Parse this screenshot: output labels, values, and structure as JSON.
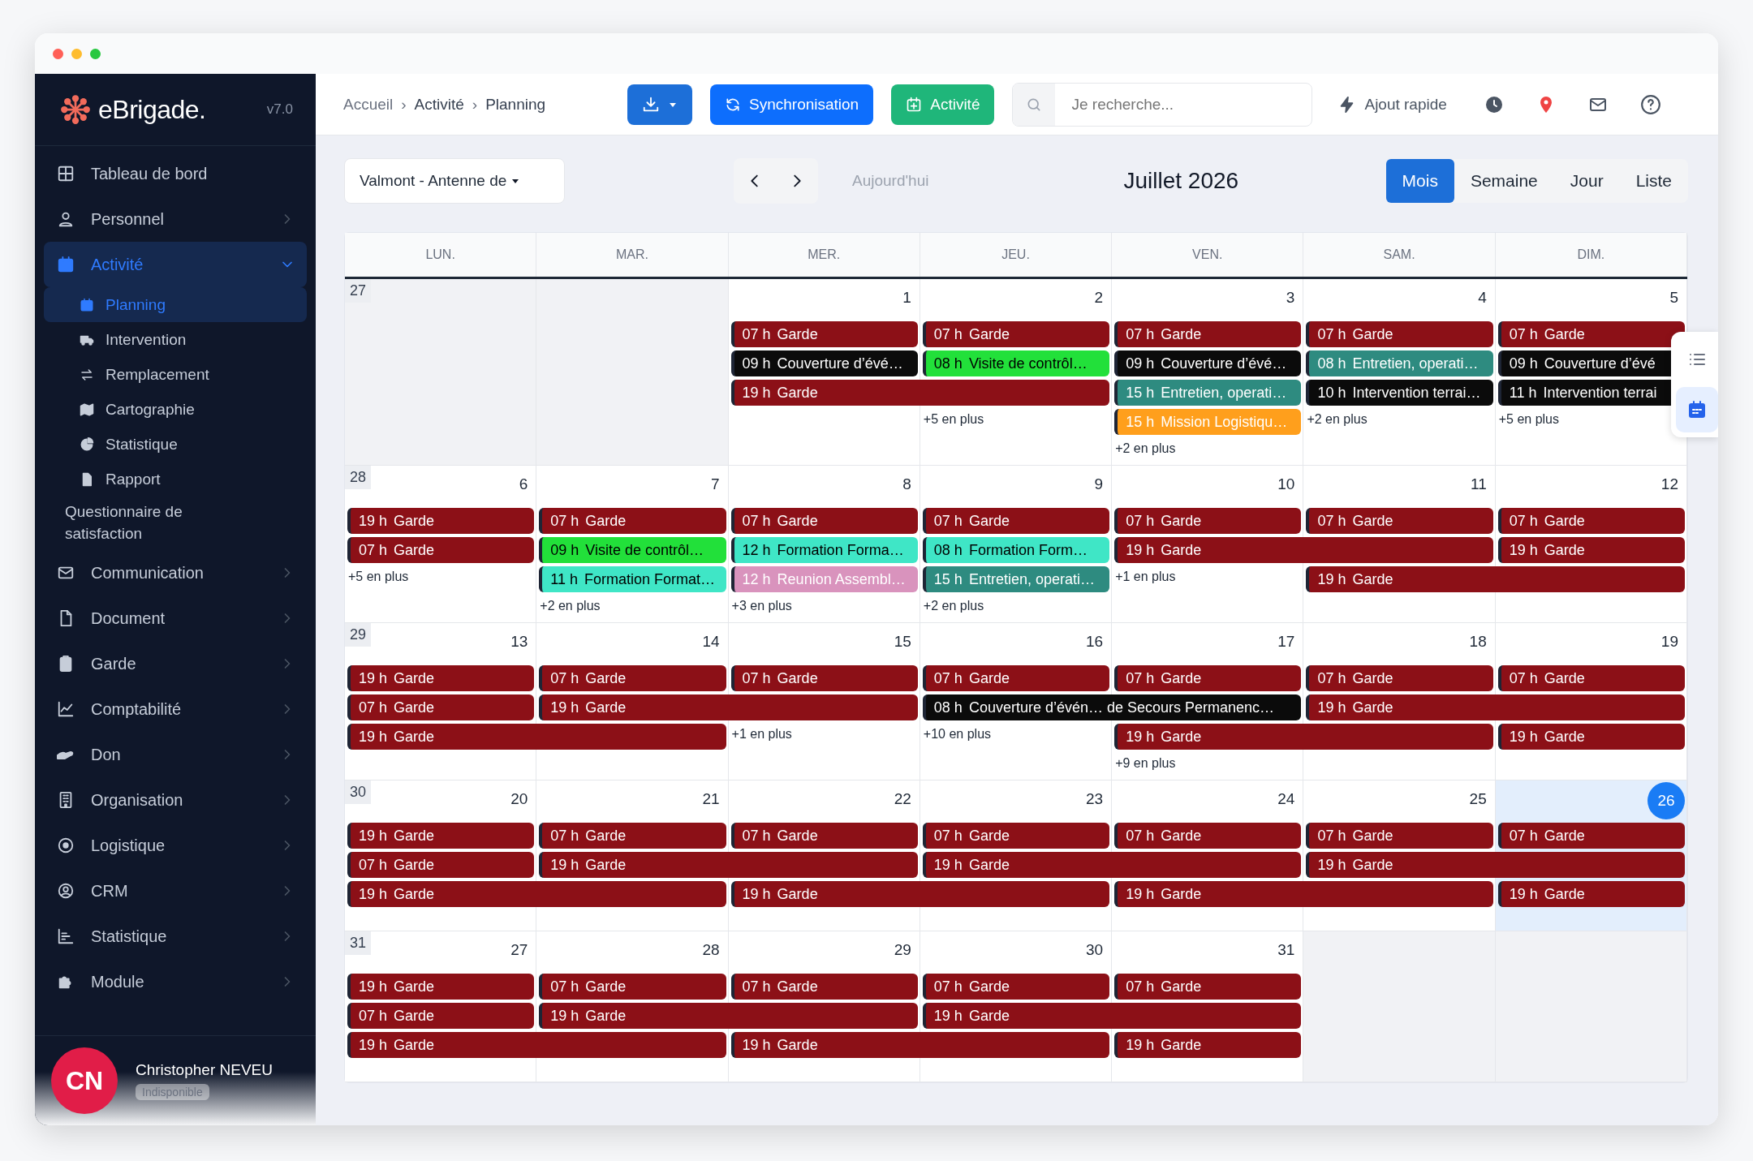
{
  "sidebar": {
    "logo": "eBrigade.",
    "version": "v7.0",
    "items": [
      {
        "label": "Tableau de bord",
        "selected": false
      },
      {
        "label": "Personnel",
        "selected": false,
        "expanded": false
      },
      {
        "label": "Activité",
        "selected": true,
        "expanded": true,
        "children": [
          {
            "label": "Planning",
            "selected": true
          },
          {
            "label": "Intervention",
            "selected": false
          },
          {
            "label": "Remplacement",
            "selected": false
          },
          {
            "label": "Cartographie",
            "selected": false
          },
          {
            "label": "Statistique",
            "selected": false
          },
          {
            "label": "Rapport",
            "selected": false
          },
          {
            "label": "Questionnaire de satisfaction",
            "selected": false
          }
        ]
      },
      {
        "label": "Communication",
        "selected": false,
        "expanded": false
      },
      {
        "label": "Document",
        "selected": false,
        "expanded": false
      },
      {
        "label": "Garde",
        "selected": false,
        "expanded": false
      },
      {
        "label": "Comptabilité",
        "selected": false,
        "expanded": false
      },
      {
        "label": "Don",
        "selected": false,
        "expanded": false
      },
      {
        "label": "Organisation",
        "selected": false,
        "expanded": false
      },
      {
        "label": "Logistique",
        "selected": false,
        "expanded": false
      },
      {
        "label": "CRM",
        "selected": false,
        "expanded": false
      },
      {
        "label": "Statistique",
        "selected": false,
        "expanded": false
      },
      {
        "label": "Module",
        "selected": false,
        "expanded": false
      }
    ],
    "user": {
      "initials": "CN",
      "name": "Christopher NEVEU",
      "status": "Indisponible"
    }
  },
  "header": {
    "breadcrumb": [
      {
        "label": "Accueil",
        "separator": "›"
      },
      {
        "label": "Activité",
        "separator": "›"
      },
      {
        "label": "Planning"
      }
    ],
    "buttons": [
      {
        "kind": "download"
      },
      {
        "kind": "sync",
        "label": "Synchronisation"
      },
      {
        "kind": "add",
        "label": "Activité"
      }
    ],
    "search": {
      "placeholder": "Je recherche..."
    },
    "quick_add": "Ajout rapide"
  },
  "toolbar": {
    "unit_select": "Valmont - Antenne de",
    "today": {
      "label": "Aujourd'hui",
      "disabled": true
    },
    "title": "Juillet 2026",
    "views": [
      {
        "label": "Mois",
        "selected": true
      },
      {
        "label": "Semaine",
        "selected": false
      },
      {
        "label": "Jour",
        "selected": false
      },
      {
        "label": "Liste",
        "selected": false
      }
    ]
  },
  "side_views": [
    {
      "kind": "list",
      "selected": false
    },
    {
      "kind": "calendar",
      "selected": true
    }
  ],
  "calendar": {
    "day_names": [
      "LUN.",
      "MAR.",
      "MER.",
      "JEU.",
      "VEN.",
      "SAM.",
      "DIM."
    ],
    "weeks": [
      {
        "number": "27",
        "days": [
          {
            "in_month": false,
            "today": false
          },
          {
            "in_month": false,
            "today": false
          },
          {
            "date": "1",
            "in_month": true,
            "today": false,
            "events": [
              {
                "time": "07 h",
                "title": "Garde",
                "color": "#8c1017",
                "continues": false
              },
              {
                "time": "09 h",
                "title": "Couverture d’évé…",
                "color": "#0b0b0b",
                "continues": false
              },
              {
                "time": "19 h",
                "title": "Garde",
                "color": "#8c1017",
                "continues": true
              }
            ]
          },
          {
            "date": "2",
            "in_month": true,
            "today": false,
            "events": [
              {
                "time": "07 h",
                "title": "Garde",
                "color": "#8c1017",
                "continues": false
              },
              {
                "time": "08 h",
                "title": "Visite de contrôl…",
                "color": "#22e03a",
                "continues": false
              }
            ],
            "more": "+5 en plus"
          },
          {
            "date": "3",
            "in_month": true,
            "today": false,
            "events": [
              {
                "time": "07 h",
                "title": "Garde",
                "color": "#8c1017",
                "continues": false
              },
              {
                "time": "09 h",
                "title": "Couverture d’évé…",
                "color": "#0b0b0b",
                "continues": false
              },
              {
                "time": "15 h",
                "title": "Entretien, operati…",
                "color": "#2e8b80",
                "continues": false
              },
              {
                "time": "15 h",
                "title": "Mission Logistiqu…",
                "color": "#ff9f1c",
                "continues": false
              }
            ],
            "more": "+2 en plus"
          },
          {
            "date": "4",
            "in_month": true,
            "today": false,
            "events": [
              {
                "time": "07 h",
                "title": "Garde",
                "color": "#8c1017",
                "continues": false
              },
              {
                "time": "08 h",
                "title": "Entretien, operati…",
                "color": "#2e8b80",
                "continues": false
              },
              {
                "time": "10 h",
                "title": "Intervention terrai…",
                "color": "#0b0b0b",
                "continues": false
              }
            ],
            "more": "+2 en plus"
          },
          {
            "date": "5",
            "in_month": true,
            "today": false,
            "events": [
              {
                "time": "07 h",
                "title": "Garde",
                "color": "#8c1017",
                "continues": false
              },
              {
                "time": "09 h",
                "title": "Couverture d’évé",
                "color": "#0b0b0b",
                "continues": false
              },
              {
                "time": "11 h",
                "title": "Intervention terrai",
                "color": "#0b0b0b",
                "continues": false
              }
            ],
            "more": "+5 en plus"
          }
        ]
      },
      {
        "number": "28",
        "days": [
          {
            "date": "6",
            "in_month": true,
            "today": false,
            "events": [
              {
                "time": "19 h",
                "title": "Garde",
                "color": "#8c1017",
                "continues": false
              },
              {
                "time": "07 h",
                "title": "Garde",
                "color": "#8c1017",
                "continues": false
              }
            ],
            "more": "+5 en plus"
          },
          {
            "date": "7",
            "in_month": true,
            "today": false,
            "events": [
              {
                "time": "07 h",
                "title": "Garde",
                "color": "#8c1017",
                "continues": false
              },
              {
                "time": "09 h",
                "title": "Visite de contrôl…",
                "color": "#22e03a",
                "continues": false
              },
              {
                "time": "11 h",
                "title": "Formation Format…",
                "color": "#3fe6c6",
                "continues": false
              }
            ],
            "more": "+2 en plus"
          },
          {
            "date": "8",
            "in_month": true,
            "today": false,
            "events": [
              {
                "time": "07 h",
                "title": "Garde",
                "color": "#8c1017",
                "continues": false
              },
              {
                "time": "12 h",
                "title": "Formation Forma…",
                "color": "#3fe6c6",
                "continues": false
              },
              {
                "time": "12 h",
                "title": "Reunion Assembl…",
                "color": "#d993bd",
                "continues": false
              }
            ],
            "more": "+3 en plus"
          },
          {
            "date": "9",
            "in_month": true,
            "today": false,
            "events": [
              {
                "time": "07 h",
                "title": "Garde",
                "color": "#8c1017",
                "continues": false
              },
              {
                "time": "08 h",
                "title": "Formation Form…",
                "color": "#3fe6c6",
                "continues": false
              },
              {
                "time": "15 h",
                "title": "Entretien, operati…",
                "color": "#2e8b80",
                "continues": false
              }
            ],
            "more": "+2 en plus"
          },
          {
            "date": "10",
            "in_month": true,
            "today": false,
            "events": [
              {
                "time": "07 h",
                "title": "Garde",
                "color": "#8c1017",
                "continues": false
              },
              {
                "time": "19 h",
                "title": "Garde",
                "color": "#8c1017",
                "continues": true
              }
            ],
            "more": "+1 en plus"
          },
          {
            "date": "11",
            "in_month": true,
            "today": false,
            "events": [
              {
                "time": "07 h",
                "title": "Garde",
                "color": "#8c1017",
                "continues": false
              },
              {
                "time": "19 h",
                "title": "Garde",
                "color": "#8c1017",
                "continues": true
              }
            ]
          },
          {
            "date": "12",
            "in_month": true,
            "today": false,
            "events": [
              {
                "time": "07 h",
                "title": "Garde",
                "color": "#8c1017",
                "continues": false
              },
              {
                "time": "19 h",
                "title": "Garde",
                "color": "#8c1017",
                "continues": false
              }
            ]
          }
        ]
      },
      {
        "number": "29",
        "days": [
          {
            "date": "13",
            "in_month": true,
            "today": false,
            "events": [
              {
                "time": "19 h",
                "title": "Garde",
                "color": "#8c1017",
                "continues": false
              },
              {
                "time": "07 h",
                "title": "Garde",
                "color": "#8c1017",
                "continues": false
              },
              {
                "time": "19 h",
                "title": "Garde",
                "color": "#8c1017",
                "continues": true
              }
            ]
          },
          {
            "date": "14",
            "in_month": true,
            "today": false,
            "events": [
              {
                "time": "07 h",
                "title": "Garde",
                "color": "#8c1017",
                "continues": false
              },
              {
                "time": "19 h",
                "title": "Garde",
                "color": "#8c1017",
                "continues": true
              }
            ]
          },
          {
            "date": "15",
            "in_month": true,
            "today": false,
            "events": [
              {
                "time": "07 h",
                "title": "Garde",
                "color": "#8c1017",
                "continues": false
              }
            ],
            "more": "+1 en plus"
          },
          {
            "date": "16",
            "in_month": true,
            "today": false,
            "events": [
              {
                "time": "07 h",
                "title": "Garde",
                "color": "#8c1017",
                "continues": false
              },
              {
                "time": "08 h",
                "title": "Couverture d’évén… de Secours Permanenc…",
                "color": "#0b0b0b",
                "continues": true
              }
            ],
            "more": "+10 en plus"
          },
          {
            "date": "17",
            "in_month": true,
            "today": false,
            "events": [
              {
                "time": "07 h",
                "title": "Garde",
                "color": "#8c1017",
                "continues": false
              },
              {
                "time": "19 h",
                "title": "Garde",
                "color": "#8c1017",
                "continues": true
              }
            ],
            "more": "+9 en plus"
          },
          {
            "date": "18",
            "in_month": true,
            "today": false,
            "events": [
              {
                "time": "07 h",
                "title": "Garde",
                "color": "#8c1017",
                "continues": false
              },
              {
                "time": "19 h",
                "title": "Garde",
                "color": "#8c1017",
                "continues": true
              }
            ]
          },
          {
            "date": "19",
            "in_month": true,
            "today": false,
            "events": [
              {
                "time": "07 h",
                "title": "Garde",
                "color": "#8c1017",
                "continues": false
              },
              {
                "time": "19 h",
                "title": "Garde",
                "color": "#8c1017",
                "continues": false
              }
            ]
          }
        ]
      },
      {
        "number": "30",
        "days": [
          {
            "date": "20",
            "in_month": true,
            "today": false,
            "events": [
              {
                "time": "19 h",
                "title": "Garde",
                "color": "#8c1017",
                "continues": false
              },
              {
                "time": "07 h",
                "title": "Garde",
                "color": "#8c1017",
                "continues": false
              },
              {
                "time": "19 h",
                "title": "Garde",
                "color": "#8c1017",
                "continues": true
              }
            ]
          },
          {
            "date": "21",
            "in_month": true,
            "today": false,
            "events": [
              {
                "time": "07 h",
                "title": "Garde",
                "color": "#8c1017",
                "continues": false
              },
              {
                "time": "19 h",
                "title": "Garde",
                "color": "#8c1017",
                "continues": true
              }
            ]
          },
          {
            "date": "22",
            "in_month": true,
            "today": false,
            "events": [
              {
                "time": "07 h",
                "title": "Garde",
                "color": "#8c1017",
                "continues": false
              },
              {
                "time": "19 h",
                "title": "Garde",
                "color": "#8c1017",
                "continues": true
              }
            ]
          },
          {
            "date": "23",
            "in_month": true,
            "today": false,
            "events": [
              {
                "time": "07 h",
                "title": "Garde",
                "color": "#8c1017",
                "continues": false
              },
              {
                "time": "19 h",
                "title": "Garde",
                "color": "#8c1017",
                "continues": true
              }
            ]
          },
          {
            "date": "24",
            "in_month": true,
            "today": false,
            "events": [
              {
                "time": "07 h",
                "title": "Garde",
                "color": "#8c1017",
                "continues": false
              },
              {
                "time": "19 h",
                "title": "Garde",
                "color": "#8c1017",
                "continues": true
              }
            ]
          },
          {
            "date": "25",
            "in_month": true,
            "today": false,
            "events": [
              {
                "time": "07 h",
                "title": "Garde",
                "color": "#8c1017",
                "continues": false
              },
              {
                "time": "19 h",
                "title": "Garde",
                "color": "#8c1017",
                "continues": true
              }
            ]
          },
          {
            "date": "26",
            "in_month": true,
            "today": true,
            "events": [
              {
                "time": "07 h",
                "title": "Garde",
                "color": "#8c1017",
                "continues": false
              },
              {
                "time": "19 h",
                "title": "Garde",
                "color": "#8c1017",
                "continues": false
              }
            ]
          }
        ]
      },
      {
        "number": "31",
        "days": [
          {
            "date": "27",
            "in_month": true,
            "today": false,
            "events": [
              {
                "time": "19 h",
                "title": "Garde",
                "color": "#8c1017",
                "continues": false
              },
              {
                "time": "07 h",
                "title": "Garde",
                "color": "#8c1017",
                "continues": false
              },
              {
                "time": "19 h",
                "title": "Garde",
                "color": "#8c1017",
                "continues": true
              }
            ]
          },
          {
            "date": "28",
            "in_month": true,
            "today": false,
            "events": [
              {
                "time": "07 h",
                "title": "Garde",
                "color": "#8c1017",
                "continues": false
              },
              {
                "time": "19 h",
                "title": "Garde",
                "color": "#8c1017",
                "continues": true
              }
            ]
          },
          {
            "date": "29",
            "in_month": true,
            "today": false,
            "events": [
              {
                "time": "07 h",
                "title": "Garde",
                "color": "#8c1017",
                "continues": false
              },
              {
                "time": "19 h",
                "title": "Garde",
                "color": "#8c1017",
                "continues": true
              }
            ]
          },
          {
            "date": "30",
            "in_month": true,
            "today": false,
            "events": [
              {
                "time": "07 h",
                "title": "Garde",
                "color": "#8c1017",
                "continues": false
              },
              {
                "time": "19 h",
                "title": "Garde",
                "color": "#8c1017",
                "continues": true
              }
            ]
          },
          {
            "date": "31",
            "in_month": true,
            "today": false,
            "events": [
              {
                "time": "07 h",
                "title": "Garde",
                "color": "#8c1017",
                "continues": false
              },
              {
                "time": "19 h",
                "title": "Garde",
                "color": "#8c1017",
                "continues": false
              }
            ]
          },
          {
            "in_month": false,
            "today": false
          },
          {
            "in_month": false,
            "today": false
          }
        ]
      }
    ]
  }
}
